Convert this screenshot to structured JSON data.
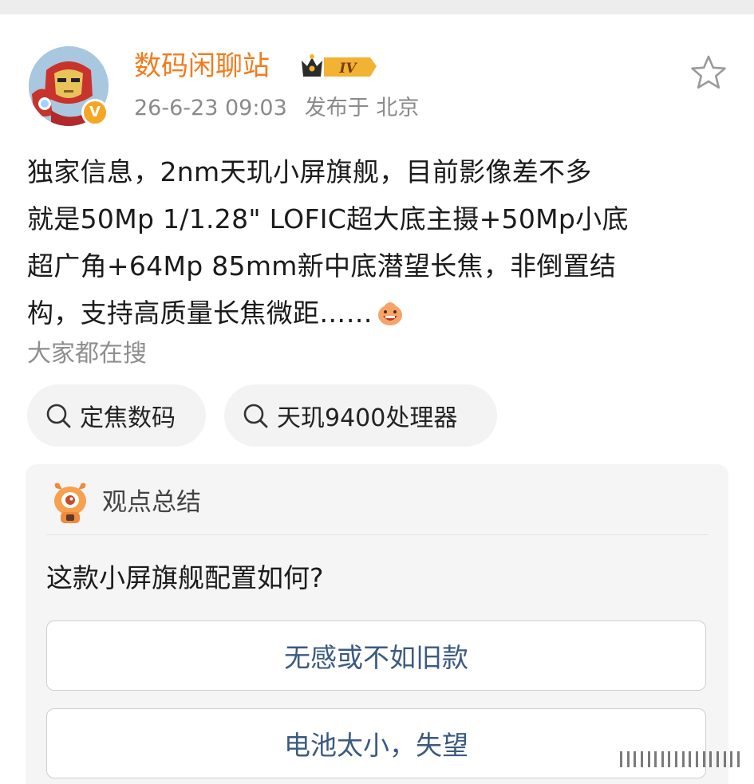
{
  "post": {
    "author": {
      "name": "数码闲聊站",
      "level_badge": "IV",
      "verified_badge": "V",
      "avatar_icon": "iron-man-avatar-icon"
    },
    "meta": {
      "date": "26-6-23 09:03",
      "location": "发布于 北京"
    },
    "text_lines": [
      "独家信息，2nm天玑小屏旗舰，目前影像差不多",
      "就是50Mp 1/1.28\" LOFIC超大底主摄+50Mp小底",
      "超广角+64Mp 85mm新中底潜望长焦，非倒置结",
      "构，支持高质量长焦微距……"
    ],
    "inline_emoji": "grinning-doge-emoji",
    "favorite_icon": "star-outline-icon"
  },
  "search": {
    "label": "大家都在搜",
    "chips": [
      {
        "label": "定焦数码",
        "icon": "search-icon"
      },
      {
        "label": "天玑9400处理器",
        "icon": "search-icon"
      }
    ]
  },
  "summary": {
    "title": "观点总结",
    "icon": "assistant-mascot-icon",
    "question": "这款小屏旗舰配置如何?",
    "options": [
      {
        "label": "无感或不如旧款"
      },
      {
        "label": "电池太小，失望"
      }
    ]
  },
  "colors": {
    "username": "#f07c1e",
    "meta": "#8a8a8a",
    "option_text": "#3b5a80",
    "card_bg": "#f5f5f5",
    "chip_bg": "#f3f3f3"
  }
}
